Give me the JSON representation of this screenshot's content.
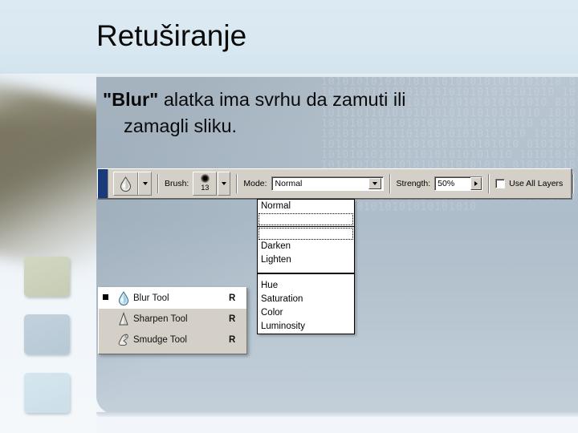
{
  "slide": {
    "title": "Retuširanje",
    "body": {
      "bold_term": "\"Blur\"",
      "line1_rest": " alatka ima svrhu da zamuti ili",
      "line2": "zamagli sliku."
    }
  },
  "toolbar": {
    "tool_icon_name": "blur-droplet-icon",
    "brush_label": "Brush:",
    "brush_size": "13",
    "mode_label": "Mode:",
    "mode_value": "Normal",
    "strength_label": "Strength:",
    "strength_value": "50%",
    "use_all_layers_label": "Use All Layers",
    "use_all_layers_checked": false,
    "palette_button_name": "brushes-palette-icon"
  },
  "mode_menu": {
    "selected": "Normal",
    "group1": [
      "Normal"
    ],
    "group2": [
      "Darken",
      "Lighten"
    ],
    "group3": [
      "Hue",
      "Saturation",
      "Color",
      "Luminosity"
    ]
  },
  "tool_flyout": {
    "items": [
      {
        "label": "Blur Tool",
        "shortcut": "R",
        "selected": true,
        "icon": "droplet-icon"
      },
      {
        "label": "Sharpen Tool",
        "shortcut": "R",
        "selected": false,
        "icon": "cone-icon"
      },
      {
        "label": "Smudge Tool",
        "shortcut": "R",
        "selected": false,
        "icon": "finger-icon"
      }
    ]
  },
  "decor": {
    "squares": [
      {
        "name": "deco-square-olive",
        "color": "#c6cdb4"
      },
      {
        "name": "deco-square-blue",
        "color": "#b7c9d6"
      },
      {
        "name": "deco-square-pale",
        "color": "#cbdfe9"
      }
    ]
  },
  "texture": {
    "binary": "1010101010101010101010101010101010 0101101010101010101010101010101010 1010101010101010101010101010101010 0101010101101010101010101010101010 1010101010101010101010101010101010 0101010101010101101010101010101010 1010101010101010101010101010101010 0101010101010101010110101010101010 1010101010101010101010101010101010 0101010101010101010101011010101010 1010101010101010101010101010101010 0101010101010101010101010101101010 1010101010101010101010101010101010"
  }
}
